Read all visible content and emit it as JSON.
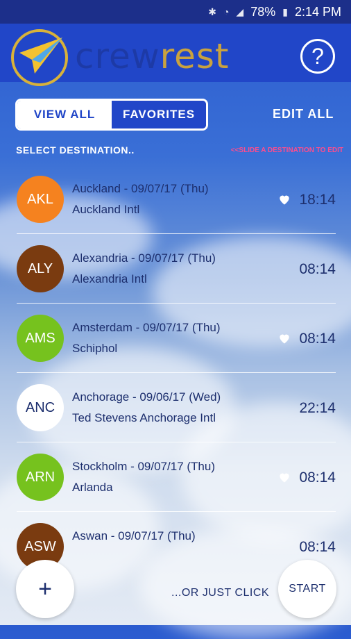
{
  "status_bar": {
    "battery": "78%",
    "time": "2:14 PM"
  },
  "app": {
    "title_part1": "crew",
    "title_part2": "rest",
    "help_label": "?"
  },
  "tabs": [
    {
      "label": "VIEW ALL",
      "active": true
    },
    {
      "label": "FAVORITES",
      "active": false
    }
  ],
  "edit_all_label": "EDIT ALL",
  "select_destination_label": "SELECT DESTINATION..",
  "slide_hint": "<<SLIDE A DESTINATION TO EDIT",
  "destinations": [
    {
      "code": "AKL",
      "color": "#f5821f",
      "city_date": "Auckland - 09/07/17 (Thu)",
      "airport": "Auckland Intl",
      "time": "18:14",
      "favorite": true
    },
    {
      "code": "ALY",
      "color": "#7a3b10",
      "city_date": "Alexandria - 09/07/17 (Thu)",
      "airport": "Alexandria Intl",
      "time": "08:14",
      "favorite": false
    },
    {
      "code": "AMS",
      "color": "#76c21e",
      "city_date": "Amsterdam - 09/07/17 (Thu)",
      "airport": "Schiphol",
      "time": "08:14",
      "favorite": true
    },
    {
      "code": "ANC",
      "color": "#ffffff",
      "city_date": "Anchorage - 09/06/17 (Wed)",
      "airport": "Ted Stevens Anchorage Intl",
      "time": "22:14",
      "favorite": false
    },
    {
      "code": "ARN",
      "color": "#76c21e",
      "city_date": "Stockholm - 09/07/17 (Thu)",
      "airport": "Arlanda",
      "time": "08:14",
      "favorite": true
    },
    {
      "code": "ASW",
      "color": "#7a3b10",
      "city_date": "Aswan - 09/07/17 (Thu)",
      "airport": "",
      "time": "08:14",
      "favorite": false
    }
  ],
  "bottom": {
    "add_label": "+",
    "just_click_label": "...OR JUST CLICK",
    "start_label": "START"
  }
}
